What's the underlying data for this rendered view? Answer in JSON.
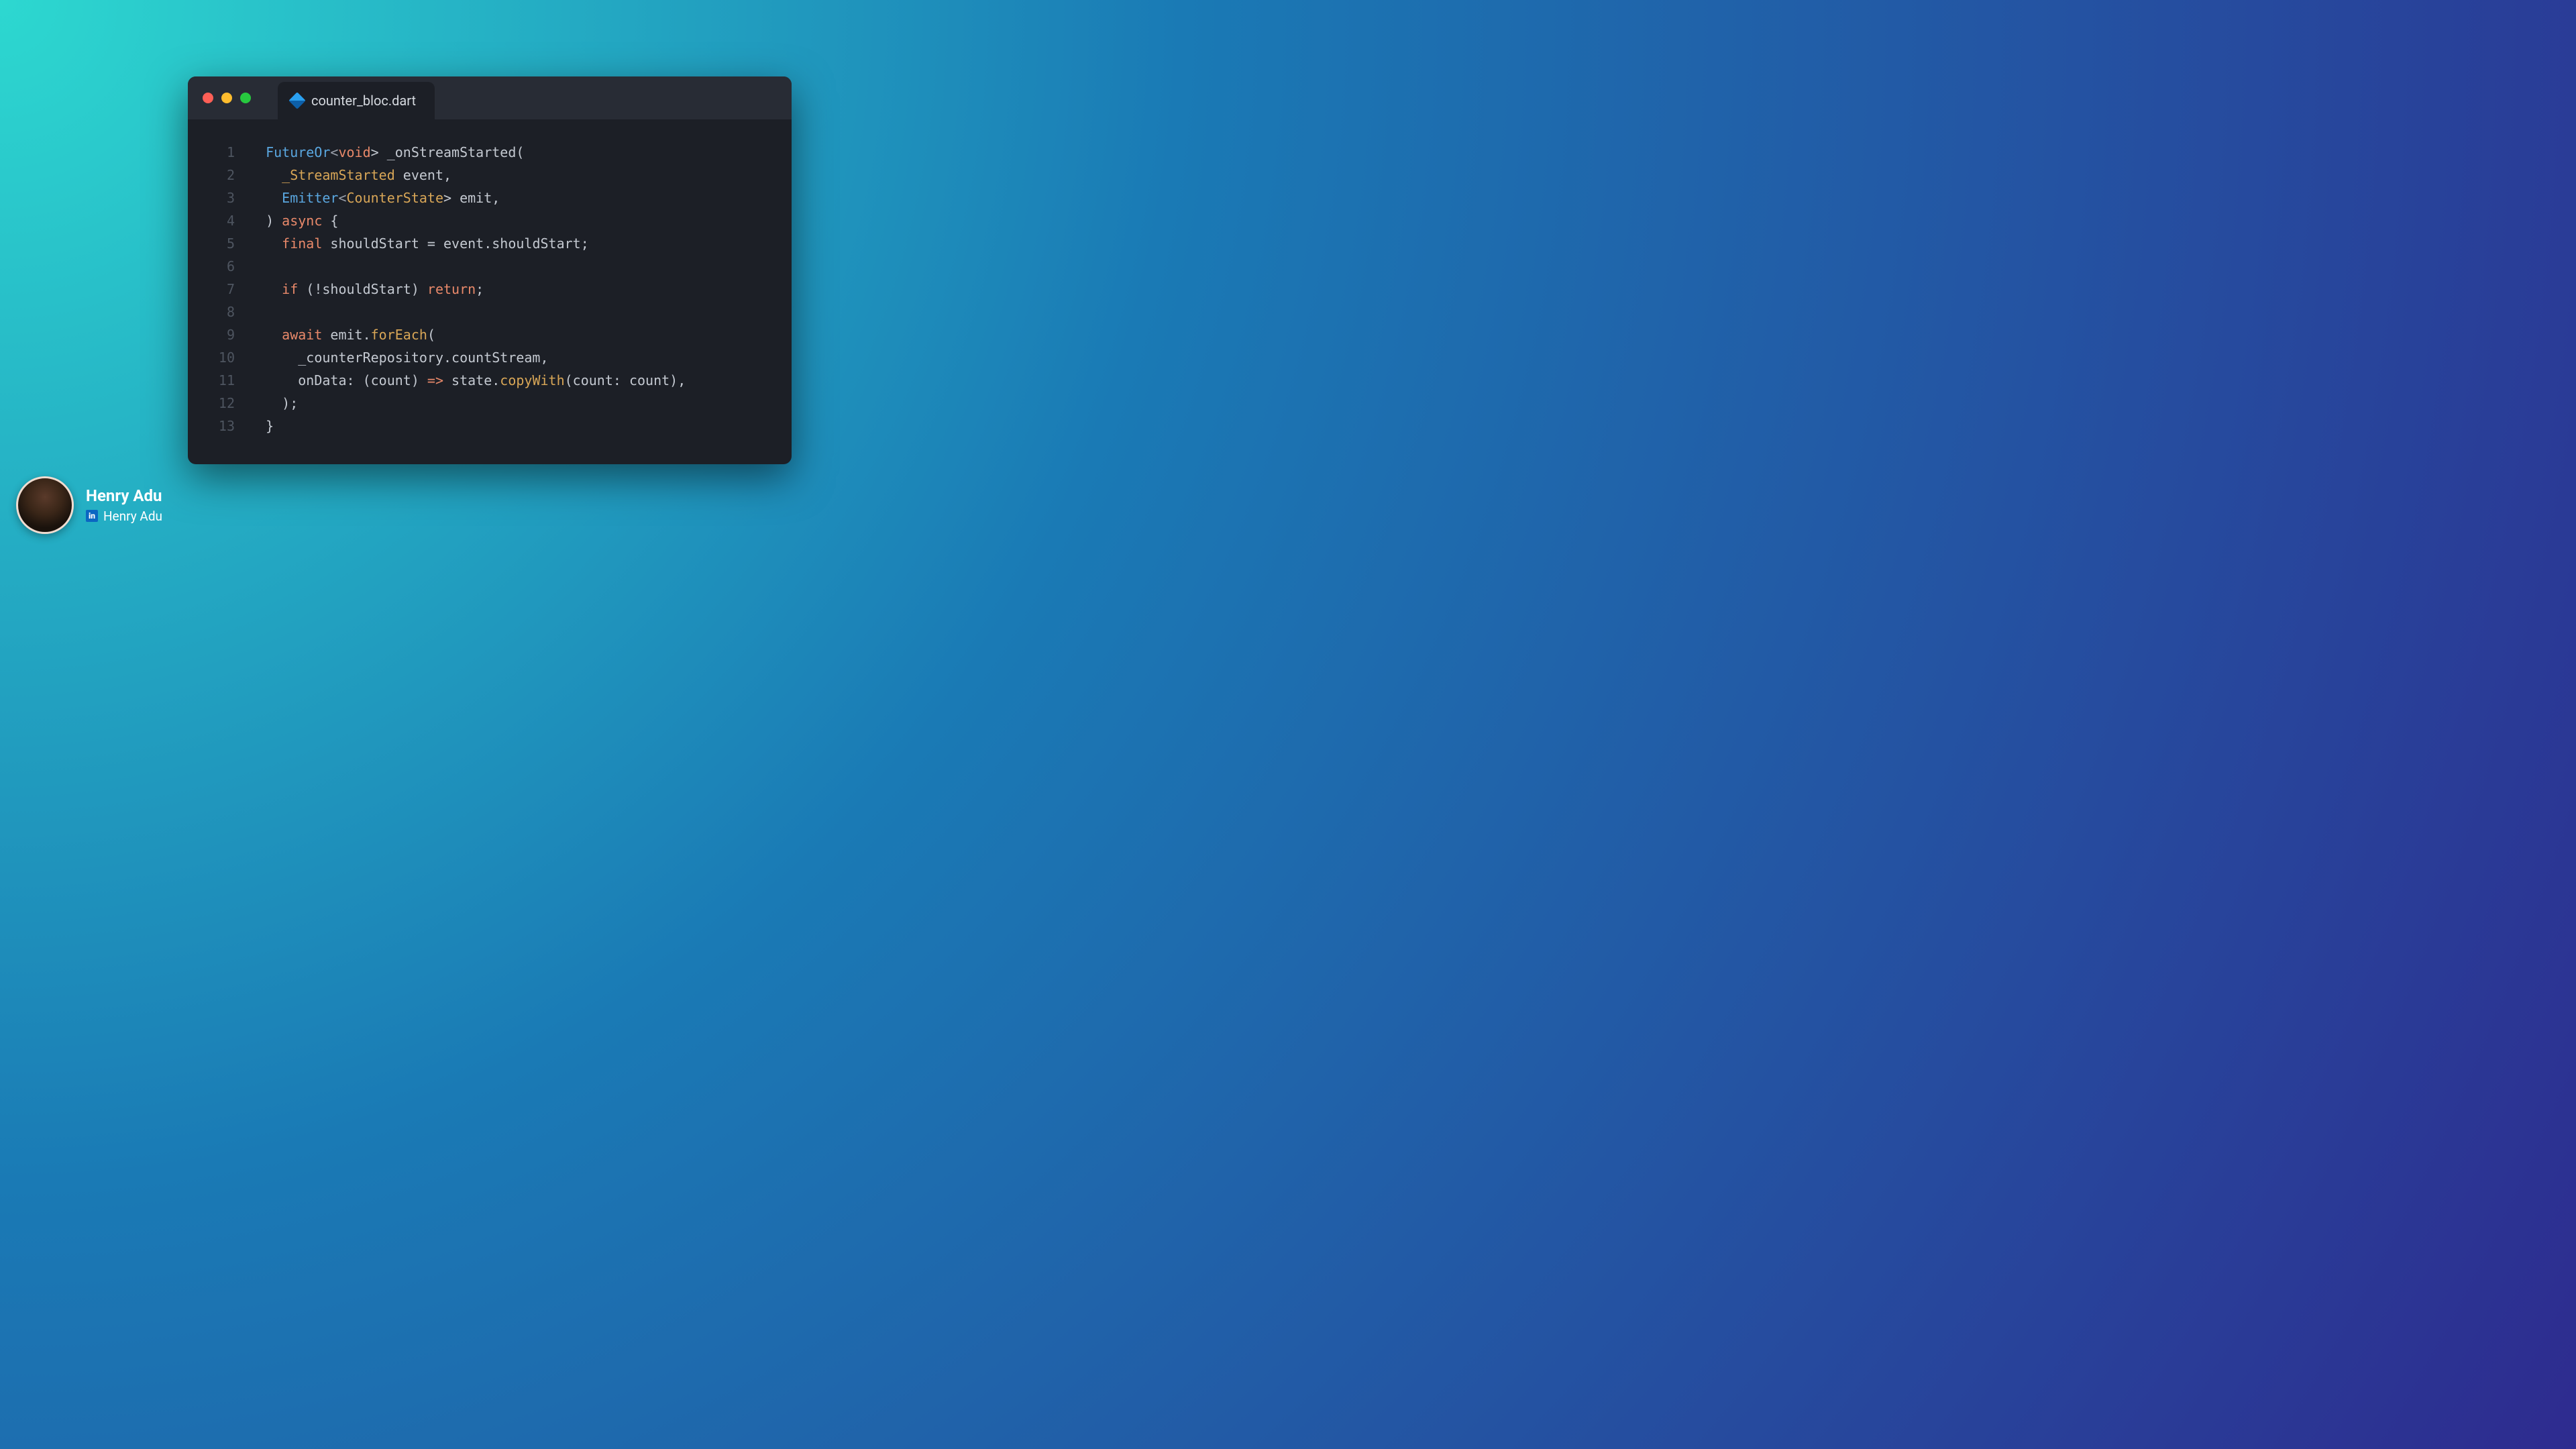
{
  "tab": {
    "filename": "counter_bloc.dart"
  },
  "author": {
    "name": "Henry Adu",
    "linkedin_label": "Henry Adu",
    "linkedin_badge": "in"
  },
  "colors": {
    "window_bg": "#1c1f26",
    "titlebar_bg": "#282c35",
    "traffic_red": "#ff5f56",
    "traffic_amber": "#ffbd2e",
    "traffic_green": "#27c93f"
  },
  "code": {
    "lines": [
      {
        "n": "1",
        "tokens": [
          {
            "t": "  ",
            "c": "default"
          },
          {
            "t": "FutureOr",
            "c": "type"
          },
          {
            "t": "<",
            "c": "punct"
          },
          {
            "t": "void",
            "c": "builtin"
          },
          {
            "t": "> _onStreamStarted(",
            "c": "default"
          }
        ]
      },
      {
        "n": "2",
        "tokens": [
          {
            "t": "    ",
            "c": "default"
          },
          {
            "t": "_StreamStarted",
            "c": "class"
          },
          {
            "t": " event,",
            "c": "default"
          }
        ]
      },
      {
        "n": "3",
        "tokens": [
          {
            "t": "    ",
            "c": "default"
          },
          {
            "t": "Emitter",
            "c": "type"
          },
          {
            "t": "<",
            "c": "punct"
          },
          {
            "t": "CounterState",
            "c": "class"
          },
          {
            "t": "> emit,",
            "c": "default"
          }
        ]
      },
      {
        "n": "4",
        "tokens": [
          {
            "t": "  ) ",
            "c": "default"
          },
          {
            "t": "async",
            "c": "builtin"
          },
          {
            "t": " {",
            "c": "default"
          }
        ]
      },
      {
        "n": "5",
        "tokens": [
          {
            "t": "    ",
            "c": "default"
          },
          {
            "t": "final",
            "c": "builtin"
          },
          {
            "t": " shouldStart = event.shouldStart;",
            "c": "default"
          }
        ]
      },
      {
        "n": "6",
        "tokens": [
          {
            "t": "",
            "c": "default"
          }
        ]
      },
      {
        "n": "7",
        "tokens": [
          {
            "t": "    ",
            "c": "default"
          },
          {
            "t": "if",
            "c": "builtin"
          },
          {
            "t": " (!shouldStart) ",
            "c": "default"
          },
          {
            "t": "return",
            "c": "builtin"
          },
          {
            "t": ";",
            "c": "default"
          }
        ]
      },
      {
        "n": "8",
        "tokens": [
          {
            "t": "",
            "c": "default"
          }
        ]
      },
      {
        "n": "9",
        "tokens": [
          {
            "t": "    ",
            "c": "default"
          },
          {
            "t": "await",
            "c": "builtin"
          },
          {
            "t": " emit.",
            "c": "default"
          },
          {
            "t": "forEach",
            "c": "func"
          },
          {
            "t": "(",
            "c": "default"
          }
        ]
      },
      {
        "n": "10",
        "tokens": [
          {
            "t": "      _counterRepository.countStream,",
            "c": "default"
          }
        ]
      },
      {
        "n": "11",
        "tokens": [
          {
            "t": "      onData: (count) ",
            "c": "default"
          },
          {
            "t": "=>",
            "c": "op"
          },
          {
            "t": " state.",
            "c": "default"
          },
          {
            "t": "copyWith",
            "c": "func"
          },
          {
            "t": "(count: count),",
            "c": "default"
          }
        ]
      },
      {
        "n": "12",
        "tokens": [
          {
            "t": "    );",
            "c": "default"
          }
        ]
      },
      {
        "n": "13",
        "tokens": [
          {
            "t": "  }",
            "c": "default"
          }
        ]
      }
    ]
  }
}
